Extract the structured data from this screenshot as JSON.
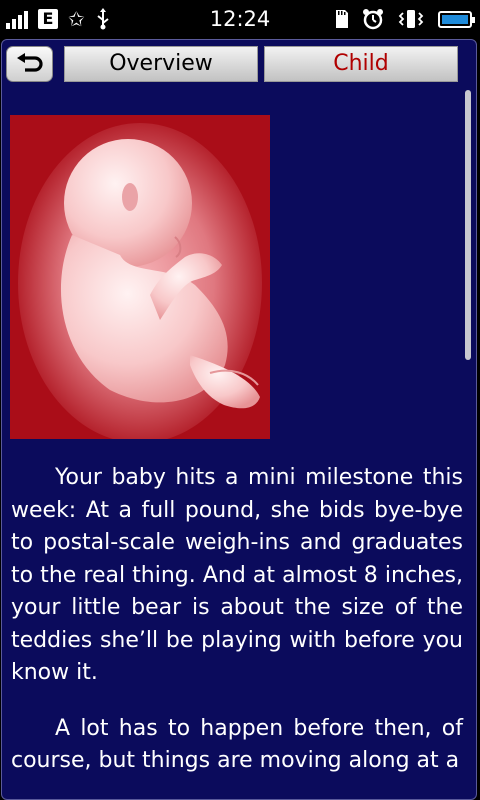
{
  "status_bar": {
    "time": "12:24",
    "network_type": "E",
    "icons": [
      "signal-icon",
      "edge-icon",
      "star-icon",
      "usb-icon",
      "sd-card-icon",
      "alarm-icon",
      "vibrate-icon",
      "battery-icon"
    ]
  },
  "header": {
    "back_icon": "back-arrow-icon",
    "tabs": [
      {
        "label": "Overview",
        "active": false
      },
      {
        "label": "Child",
        "active": true
      }
    ]
  },
  "main": {
    "image": "fetus-illustration",
    "paragraphs": [
      "Your baby hits a mini milestone this week: At a full pound, she bids bye-bye to postal-scale weigh-ins and graduates to the real thing. And at almost 8 inches, your little bear is about the size of the teddies she’ll be playing with before you know it.",
      "A lot has to happen before then, of course, but things are moving along at a"
    ]
  },
  "colors": {
    "panel_bg": "#0b0b5c",
    "image_bg": "#aa0d18",
    "active_tab_text": "#b00000"
  }
}
